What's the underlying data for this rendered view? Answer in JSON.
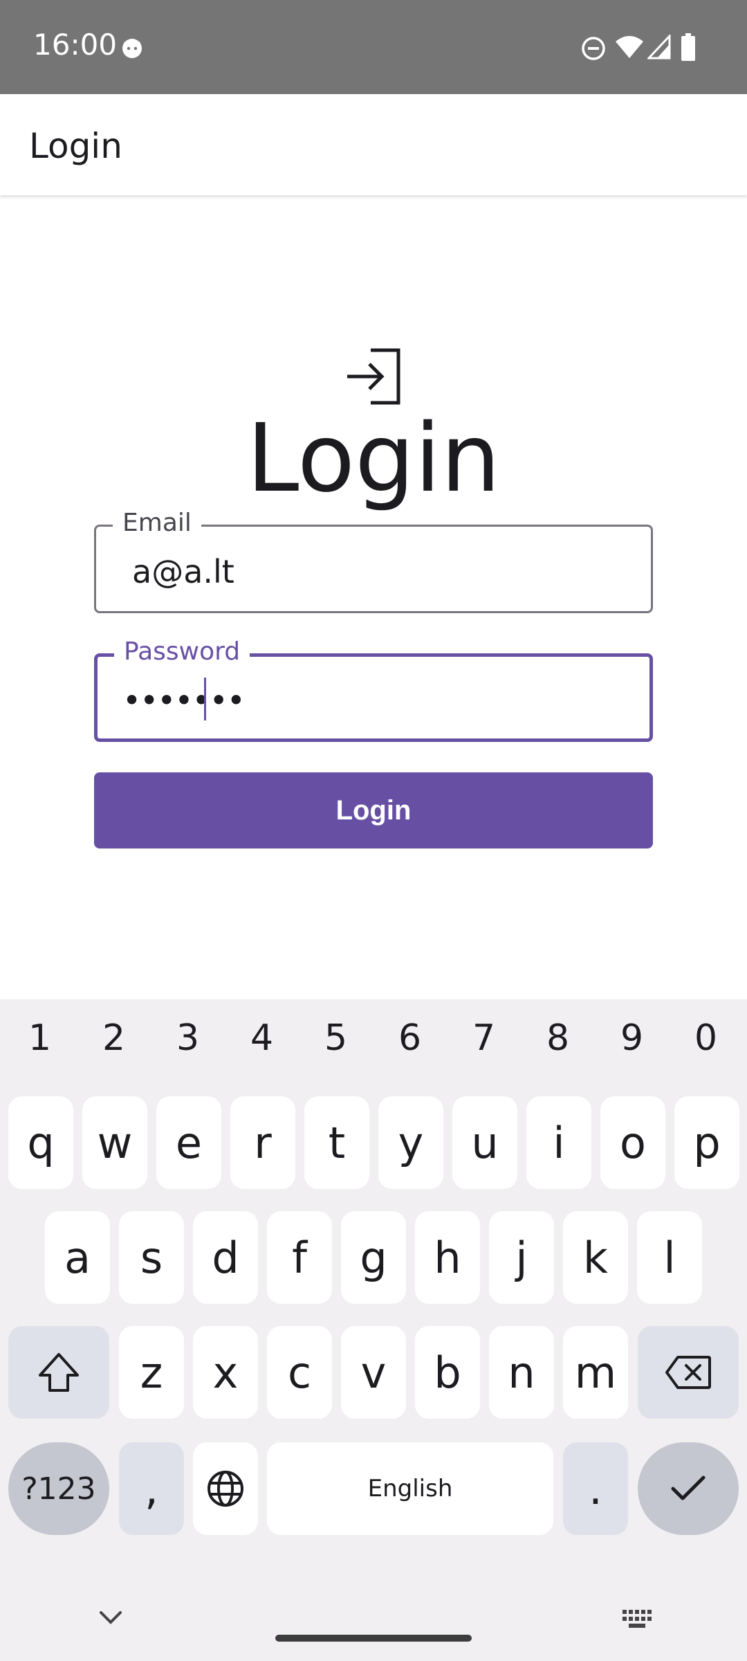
{
  "status_bar": {
    "time": "16:00",
    "icons": [
      "cat-face-icon",
      "do-not-disturb-icon",
      "wifi-icon",
      "signal-icon",
      "battery-icon"
    ]
  },
  "app_bar": {
    "title": "Login"
  },
  "form": {
    "heading": "Login",
    "icon": "login-icon",
    "email": {
      "label": "Email",
      "value": "a@a.lt"
    },
    "password": {
      "label": "Password",
      "value": "•••••••"
    },
    "submit_label": "Login"
  },
  "keyboard": {
    "number_row": [
      "1",
      "2",
      "3",
      "4",
      "5",
      "6",
      "7",
      "8",
      "9",
      "0"
    ],
    "row1": [
      "q",
      "w",
      "e",
      "r",
      "t",
      "y",
      "u",
      "i",
      "o",
      "p"
    ],
    "row2": [
      "a",
      "s",
      "d",
      "f",
      "g",
      "h",
      "j",
      "k",
      "l"
    ],
    "row3": [
      "z",
      "x",
      "c",
      "v",
      "b",
      "n",
      "m"
    ],
    "symbols_key": "?123",
    "comma_key": ",",
    "space_label": "English",
    "period_key": ".",
    "icons": [
      "shift-icon",
      "backspace-icon",
      "globe-icon",
      "checkmark-icon",
      "chevron-down-icon",
      "keyboard-icon"
    ]
  },
  "colors": {
    "accent": "#6750a4",
    "status_bar": "#757575",
    "keyboard_bg": "#f1eff2",
    "outline": "#79747e"
  }
}
